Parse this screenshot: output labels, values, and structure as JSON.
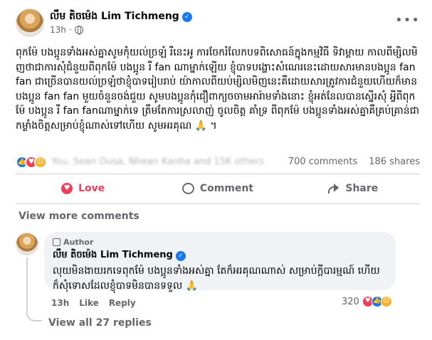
{
  "post": {
    "author_name": "លឹម តិចម៉េង Lim Tichmeng",
    "timestamp": "13h",
    "body": "ពុកម៉ែ បងប្អូនទាំងអស់គ្នាសូមកុំយល់ច្រឡំ រឺនេះអូ ការចែករំលែកបទពិសោធន៍ក្នុងកម្មវិធី ទិវាម្តាយ កាលពីម្សិលមិញថាជាការសុំជំនួយពីពុកម៉ែ បងប្អូន រឺ fan ណាម្នាក់ឡើយ ខ្ញុំបាទបង្ហោះសំណេរនេះដោយសារមានបងប្អូន fan fan ជាច្រើនបានយល់ច្រឡំថាខ្ញុំបាទរៀបរាប់ យ៉ាកាលពីយប់ម្សិលមិញនេះគឺដោយសារត្រូវការជំនួយហើយក៏មានបងប្អូន fan fan មួយចំនួនចង់ជួយ សូមបងប្អូនកុំជឿពាក្យចចាមអារ៉ាមទាំងនោះ ខ្ញុំអត់នែលបានស្នើរសុំ អ្វីពីពុកម៉ែ បងប្អូន រឺ fan fanណាម្នាក់ទេ ត្រឹមតែការស្រលាញ់ ចូលចិត្ត គាំទ្រ ពីពុកម៉ែ បងប្អូនទាំងអស់គ្នាគឺគ្រប់គ្រាន់ជាកម្លាំងចិត្តសម្រាប់ខ្ញុំណាស់ទៅហើយ សូមអរគុណ 🙏 ។"
  },
  "reactions": {
    "names": "You, Sean Ousa, Nhean Kanha and 15K others",
    "comments_count": "700 comments",
    "shares_count": "186 shares"
  },
  "actions": {
    "love_label": "Love",
    "comment_label": "Comment",
    "share_label": "Share"
  },
  "view_more_comments": "View more comments",
  "comment": {
    "badge": "Author",
    "author_name": "លឹម តិចម៉េង Lim Tichmeng",
    "text": "លុយមិនងាយរកទេពុកម៉ែ បងប្អូនទាំងអស់គ្នា តែក៏អរគុណណាស់ សម្រាប់ក្តីបារម្មណ៍ ហើយក៏សុំទោសដែលខ្ញុំបាទមិនបានទទួល 🙏",
    "timestamp": "13h",
    "like_label": "Like",
    "reply_label": "Reply",
    "reaction_count": "320",
    "view_replies": "View all 27 replies"
  },
  "colors": {
    "love": "#f33e58",
    "like": "#1877f2",
    "care": "#f7b125",
    "muted_text": "#65676b",
    "bubble": "#f0f2f5"
  },
  "icons": [
    "verified-icon",
    "globe-icon",
    "more-icon",
    "heart-icon",
    "comment-icon",
    "share-icon",
    "author-badge-icon"
  ]
}
